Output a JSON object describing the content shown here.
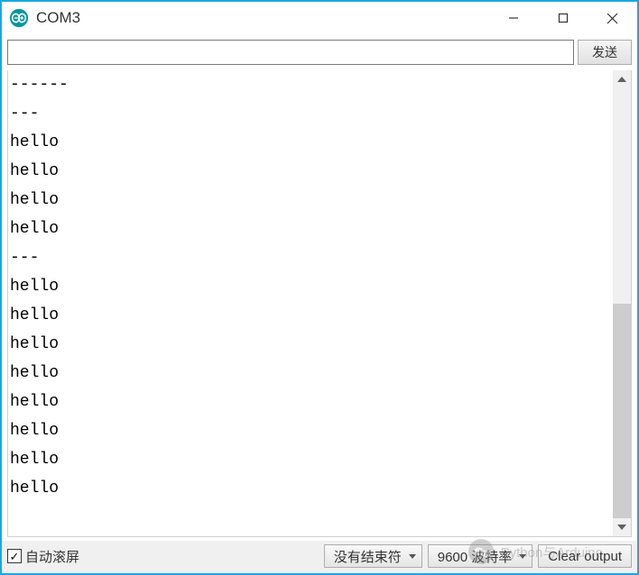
{
  "window": {
    "title": "COM3"
  },
  "toolbar": {
    "input_value": "",
    "send_label": "发送"
  },
  "output": {
    "lines": [
      "------",
      "---",
      "hello",
      "hello",
      "hello",
      "hello",
      "---",
      "hello",
      "hello",
      "hello",
      "hello",
      "hello",
      "hello",
      "hello",
      "hello",
      ""
    ],
    "scroll_thumb_top_pct": 50,
    "scroll_thumb_height_pct": 50
  },
  "footer": {
    "autoscroll_checked": true,
    "autoscroll_label": "自动滚屏",
    "line_ending_selected": "没有结束符",
    "baud_selected": "9600 波特率",
    "clear_label": "Clear output"
  },
  "watermark": {
    "text": "Python与Arduino"
  }
}
